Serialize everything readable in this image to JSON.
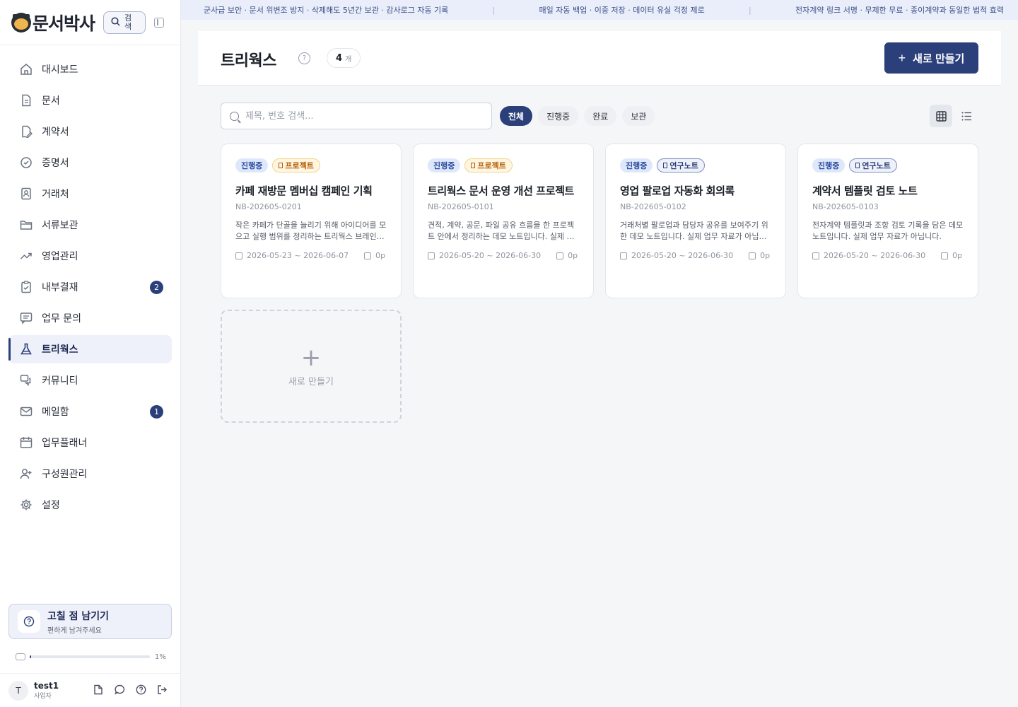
{
  "brand": {
    "name": "문서박사",
    "search_label": "검색"
  },
  "nav": [
    {
      "label": "대시보드",
      "icon": "home-icon"
    },
    {
      "label": "문서",
      "icon": "document-icon"
    },
    {
      "label": "계약서",
      "icon": "contract-icon"
    },
    {
      "label": "증명서",
      "icon": "certificate-icon"
    },
    {
      "label": "거래처",
      "icon": "contact-card-icon"
    },
    {
      "label": "서류보관",
      "icon": "folder-icon"
    },
    {
      "label": "영업관리",
      "icon": "trend-icon"
    },
    {
      "label": "내부결재",
      "icon": "clipboard-check-icon",
      "badge": "2"
    },
    {
      "label": "업무 문의",
      "icon": "message-square-icon"
    },
    {
      "label": "트리웍스",
      "icon": "flask-icon",
      "active": true
    },
    {
      "label": "커뮤니티",
      "icon": "chat-bubbles-icon"
    },
    {
      "label": "메일함",
      "icon": "mail-icon",
      "badge": "1"
    },
    {
      "label": "업무플래너",
      "icon": "calendar-icon"
    },
    {
      "label": "구성원관리",
      "icon": "user-plus-icon"
    },
    {
      "label": "설정",
      "icon": "gear-icon"
    }
  ],
  "feedback": {
    "title": "고칠 점 남기기",
    "subtitle": "편하게 남겨주세요"
  },
  "storage": {
    "percent_label": "1%",
    "fill": 0.01
  },
  "user": {
    "initial": "T",
    "name": "test1",
    "role": "사업자"
  },
  "banner": [
    "군사급 보안 · 문서 위변조 방지 · 삭제해도 5년간 보관 · 감사로그 자동 기록",
    "매일 자동 백업 · 이중 저장 · 데이터 유실 걱정 제로",
    "전자계약 링크 서명 · 무제한 무료 · 종이계약과 동일한 법적 효력"
  ],
  "banner_separator": "|",
  "page": {
    "title": "트리웍스",
    "help": "?",
    "count": "4",
    "count_unit": "개",
    "new_button": "새로 만들기",
    "plus": "+"
  },
  "search": {
    "placeholder": "제목, 번호 검색..."
  },
  "filters": [
    "전체",
    "진행중",
    "완료",
    "보관"
  ],
  "active_filter": 0,
  "cards": [
    {
      "status": "진행중",
      "type": "프로젝트",
      "type_class": "project",
      "title": "카페 재방문 멤버십 캠페인 기획",
      "code": "NB-202605-0201",
      "desc": "작은 카페가 단골을 늘리기 위해 아이디어를 모으고 실행 범위를 정리하는 트리웍스 브레인스토밍 예시입니다.",
      "dates": "2026-05-23 ~ 2026-06-07",
      "pages": "0p"
    },
    {
      "status": "진행중",
      "type": "프로젝트",
      "type_class": "project",
      "title": "트리웍스 문서 운영 개선 프로젝트",
      "code": "NB-202605-0101",
      "desc": "견적, 계약, 공문, 파일 공유 흐름을 한 프로젝트 안에서 정리하는 데모 노트입니다. 실제 업무 자료가 아닙니다.",
      "dates": "2026-05-20 ~ 2026-06-30",
      "pages": "0p"
    },
    {
      "status": "진행중",
      "type": "연구노트",
      "type_class": "research",
      "title": "영업 팔로업 자동화 회의록",
      "code": "NB-202605-0102",
      "desc": "거래처별 팔로업과 담당자 공유를 보여주기 위한 데모 노트입니다. 실제 업무 자료가 아닙니다.",
      "dates": "2026-05-20 ~ 2026-06-30",
      "pages": "0p"
    },
    {
      "status": "진행중",
      "type": "연구노트",
      "type_class": "research",
      "title": "계약서 템플릿 검토 노트",
      "code": "NB-202605-0103",
      "desc": "전자계약 템플릿과 조항 검토 기록을 담은 데모 노트입니다. 실제 업무 자료가 아닙니다.",
      "dates": "2026-05-20 ~ 2026-06-30",
      "pages": "0p"
    }
  ],
  "new_card": {
    "plus": "+",
    "label": "새로 만들기"
  },
  "colors": {
    "accent": "#2b3f7a",
    "banner_bg": "#e9eefa",
    "status_bg": "#dfe7fb",
    "project_tag": "#b65b00"
  }
}
